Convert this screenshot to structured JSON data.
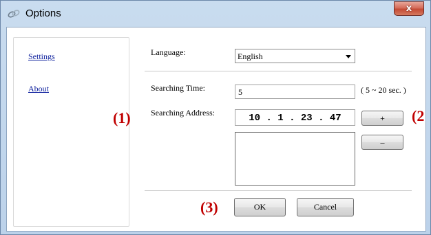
{
  "window": {
    "title": "Options",
    "close_glyph": "x"
  },
  "sidebar": {
    "items": [
      {
        "label": "Settings"
      },
      {
        "label": "About"
      }
    ]
  },
  "form": {
    "language_label": "Language:",
    "language_value": "English",
    "searching_time_label": "Searching Time:",
    "searching_time_value": "5",
    "searching_time_hint": "( 5 ~ 20 sec. )",
    "searching_address_label": "Searching Address:",
    "address_value": "10 . 1 . 23 . 47",
    "add_label": "+",
    "remove_label": "–",
    "ok_label": "OK",
    "cancel_label": "Cancel"
  },
  "annotations": {
    "a1": "(1)",
    "a2": "(2",
    "a3": "(3)"
  },
  "colors": {
    "annotation": "#c00000",
    "link": "#0a1d9c",
    "close": "#c44a35"
  }
}
